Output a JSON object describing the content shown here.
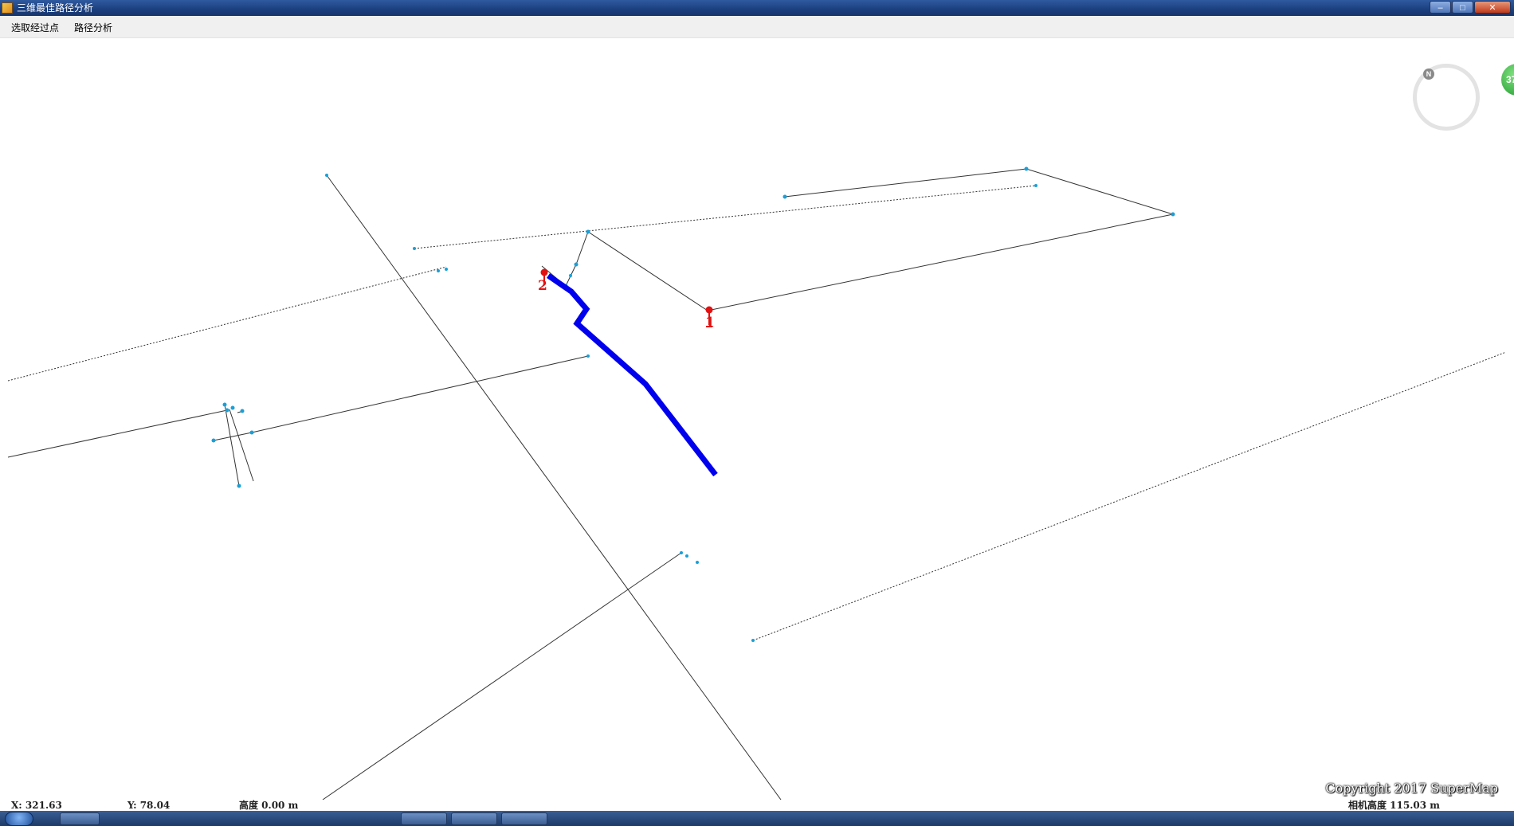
{
  "window": {
    "title": "三维最佳路径分析",
    "controls": [
      "minimize",
      "maximize",
      "close"
    ]
  },
  "menu": {
    "items": [
      "选取经过点",
      "路径分析"
    ]
  },
  "scene": {
    "route_color": "#0000ee",
    "marker_color": "#e11111",
    "node_color": "#1a9fd6",
    "markers": [
      {
        "label": "1"
      },
      {
        "label": "2"
      }
    ]
  },
  "compass": {
    "north_label": "N"
  },
  "badge": {
    "value": "37"
  },
  "status": {
    "x": "X: 321.63",
    "y": "Y: 78.04",
    "height": "高度 0.00 m",
    "camera_height": "相机高度 115.03 m"
  },
  "copyright": "Copyright 2017 SuperMap"
}
